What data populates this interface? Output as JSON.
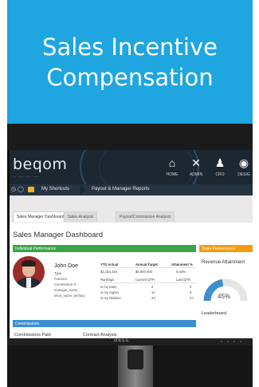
{
  "banner": {
    "title_line1": "Sales Incentive",
    "title_line2": "Compensation"
  },
  "app": {
    "logo": "beqom",
    "tagline": "... ...... ...... ......",
    "nav": [
      {
        "icon": "home-icon",
        "glyph": "⌂",
        "label": "HOME"
      },
      {
        "icon": "tools-icon",
        "glyph": "✕",
        "label": "ADMIN"
      },
      {
        "icon": "people-icon",
        "glyph": "♟",
        "label": "CRO"
      },
      {
        "icon": "globe-icon",
        "glyph": "◉",
        "label": "DESIG"
      }
    ],
    "shortcut_bar": {
      "my_shortcuts": "My Shortcuts",
      "breadcrumb": "Payout & Manager Reports"
    },
    "tabs": [
      {
        "label": "Sales Manager Dashboard",
        "active": true
      },
      {
        "label": "Sales Analysis",
        "active": false
      },
      {
        "label": "Payout/Commission Analysis",
        "active": false
      }
    ],
    "page_heading": "Sales Manager Dashboard",
    "individual_panel": {
      "title": "Individual Performance",
      "name": "John Doe",
      "fields": [
        "Type",
        "Function",
        "Commission %",
        "manager_name",
        "short_name_territory"
      ],
      "kpi_headers": [
        "YTD Actual",
        "Annual Target",
        "Attainment %"
      ],
      "kpi_row1": [
        "$2,154,316",
        "$5,000,000",
        "0.43%"
      ],
      "kpi_headers2": [
        "Rankings",
        "Current QTR",
        "Last QTR"
      ],
      "kpi_rows": [
        [
          "in my team",
          "2",
          "3"
        ],
        [
          "in my region",
          "11",
          "9"
        ],
        [
          "in my Division",
          "23",
          "27"
        ]
      ]
    },
    "team_panel": {
      "title": "Team Performance",
      "subtitle": "Revenue Attainment",
      "gauge_value": "45%",
      "gauge_fraction": 0.45,
      "leaderboard": "Leaderboard"
    },
    "commissions_panel": {
      "title": "Commissions",
      "sub1": "Commissions Paid",
      "sub2": "Contract Analysis"
    },
    "monitor_brand": "DELL"
  }
}
